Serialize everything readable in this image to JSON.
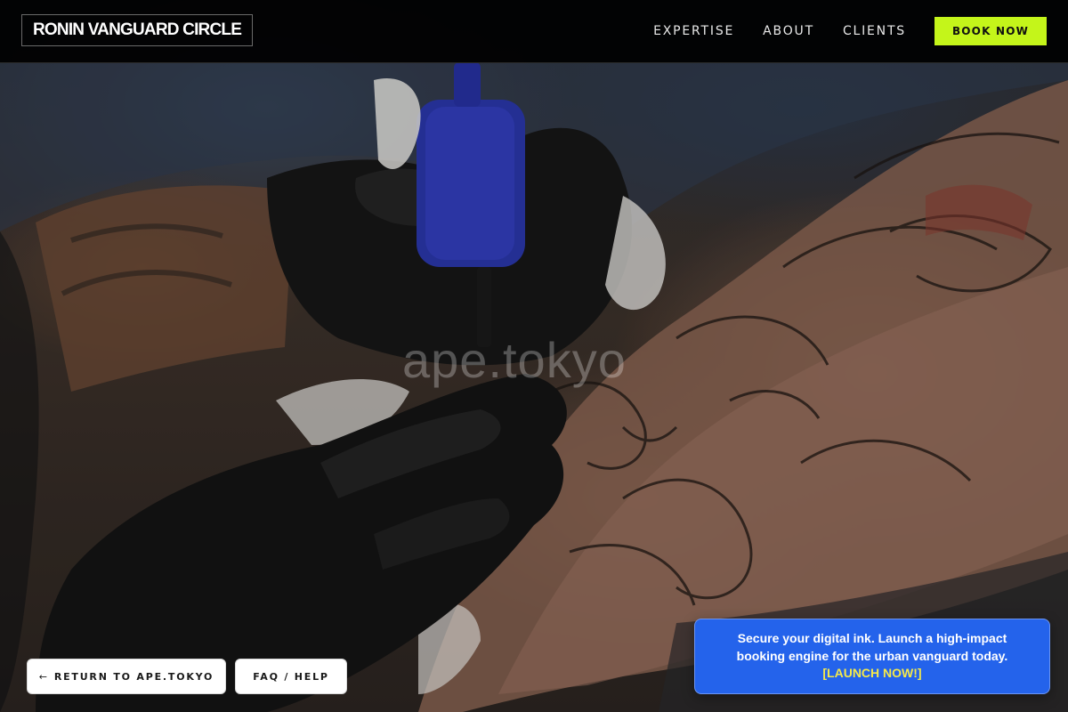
{
  "header": {
    "brand": "RONIN VANGUARD CIRCLE",
    "nav": [
      {
        "label": "EXPERTISE"
      },
      {
        "label": "ABOUT"
      },
      {
        "label": "CLIENTS"
      }
    ],
    "cta_label": "BOOK NOW"
  },
  "hero": {
    "watermark": "ape.tokyo"
  },
  "footer_buttons": {
    "return_label": "RETURN TO APE.TOKYO",
    "faq_label": "FAQ / HELP"
  },
  "promo": {
    "text": "Secure your digital ink. Launch a high-impact booking engine for the urban vanguard today.",
    "link_label": "[LAUNCH NOW!]"
  },
  "colors": {
    "accent_lime": "#c4f51a",
    "promo_blue": "#2463eb",
    "promo_link": "#f5e94a",
    "navbar_bg": "#000000"
  },
  "icons": {
    "return_arrow": "arrow-left-icon"
  }
}
